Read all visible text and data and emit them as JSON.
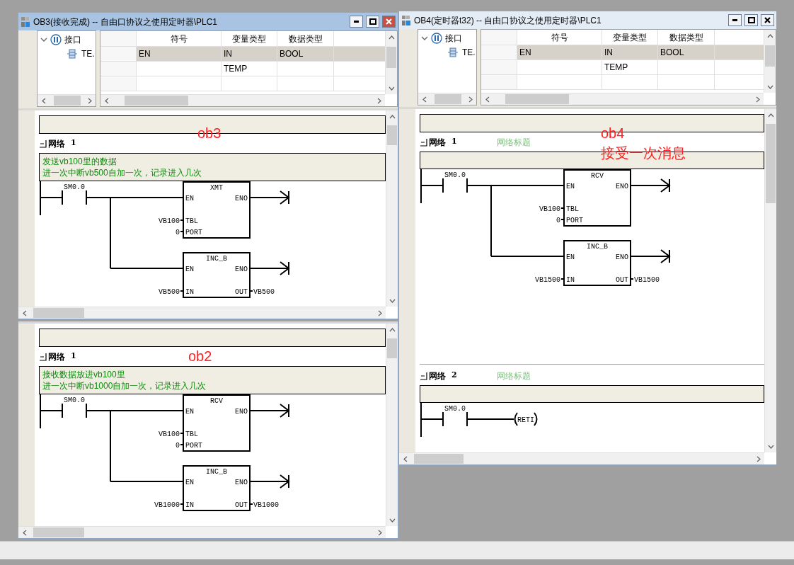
{
  "windows": [
    {
      "title": "OB3(接收完成) -- 自由口协议之使用定时器\\PLC1",
      "active": true,
      "interface": {
        "tree": [
          {
            "label": "接口",
            "expanded": true,
            "children": [
              {
                "label": "TE."
              }
            ]
          }
        ],
        "columns": [
          "符号",
          "变量类型",
          "数据类型"
        ],
        "rows": [
          {
            "symbol": "EN",
            "var_type": "IN",
            "data_type": "BOOL",
            "selected": true
          },
          {
            "var_type": "TEMP",
            "selected": false
          },
          {
            "selected": false
          }
        ]
      },
      "ladder": {
        "networks": [
          {
            "label": "网络",
            "number": "1",
            "comment": [
              "发送vb100里的数据",
              "进一次中断vb500自加一次，记录进入几次"
            ],
            "contact": "SM0.0",
            "kind": "boxes",
            "boxes": [
              {
                "name": "XMT",
                "inputs": [
                  {
                    "pin": "EN"
                  },
                  {
                    "pin": "TBL",
                    "value": "VB100"
                  },
                  {
                    "pin": "PORT",
                    "value": "0"
                  }
                ],
                "outputs": [
                  {
                    "pin": "ENO"
                  }
                ]
              },
              {
                "name": "INC_B",
                "inputs": [
                  {
                    "pin": "EN"
                  },
                  {
                    "pin": "IN",
                    "value": "VB500"
                  }
                ],
                "outputs": [
                  {
                    "pin": "ENO"
                  },
                  {
                    "pin": "OUT",
                    "value": "VB500"
                  }
                ]
              }
            ]
          }
        ]
      },
      "annotations": [
        "ob3"
      ]
    },
    {
      "title": "OB4(定时器t32) -- 自由口协议之使用定时器\\PLC1",
      "active": false,
      "interface": {
        "tree": [
          {
            "label": "接口",
            "expanded": true,
            "children": [
              {
                "label": "TE."
              }
            ]
          }
        ],
        "columns": [
          "符号",
          "变量类型",
          "数据类型"
        ],
        "rows": [
          {
            "symbol": "EN",
            "var_type": "IN",
            "data_type": "BOOL",
            "selected": true
          },
          {
            "var_type": "TEMP",
            "selected": false
          },
          {
            "selected": false
          }
        ]
      },
      "ladder": {
        "networks": [
          {
            "label": "网络",
            "number": "1",
            "title": "网络标题",
            "contact": "SM0.0",
            "kind": "boxes",
            "boxes": [
              {
                "name": "RCV",
                "inputs": [
                  {
                    "pin": "EN"
                  },
                  {
                    "pin": "TBL",
                    "value": "VB100"
                  },
                  {
                    "pin": "PORT",
                    "value": "0"
                  }
                ],
                "outputs": [
                  {
                    "pin": "ENO"
                  }
                ]
              },
              {
                "name": "INC_B",
                "inputs": [
                  {
                    "pin": "EN"
                  },
                  {
                    "pin": "IN",
                    "value": "VB1500"
                  }
                ],
                "outputs": [
                  {
                    "pin": "ENO"
                  },
                  {
                    "pin": "OUT",
                    "value": "VB1500"
                  }
                ]
              }
            ]
          },
          {
            "label": "网络",
            "number": "2",
            "title": "网络标题",
            "contact": "SM0.0",
            "kind": "coil",
            "coil": "RETI"
          }
        ]
      },
      "annotations": [
        "ob4",
        "接受一次消息"
      ]
    },
    {
      "ladder": {
        "networks": [
          {
            "label": "网络",
            "number": "1",
            "comment": [
              "接收数据放进vb100里",
              "进一次中断vb1000自加一次，记录进入几次"
            ],
            "contact": "SM0.0",
            "kind": "boxes",
            "boxes": [
              {
                "name": "RCV",
                "inputs": [
                  {
                    "pin": "EN"
                  },
                  {
                    "pin": "TBL",
                    "value": "VB100"
                  },
                  {
                    "pin": "PORT",
                    "value": "0"
                  }
                ],
                "outputs": [
                  {
                    "pin": "ENO"
                  }
                ]
              },
              {
                "name": "INC_B",
                "inputs": [
                  {
                    "pin": "EN"
                  },
                  {
                    "pin": "IN",
                    "value": "VB1000"
                  }
                ],
                "outputs": [
                  {
                    "pin": "ENO"
                  },
                  {
                    "pin": "OUT",
                    "value": "VB1000"
                  }
                ]
              }
            ]
          }
        ]
      },
      "annotations": [
        "ob2"
      ]
    }
  ]
}
